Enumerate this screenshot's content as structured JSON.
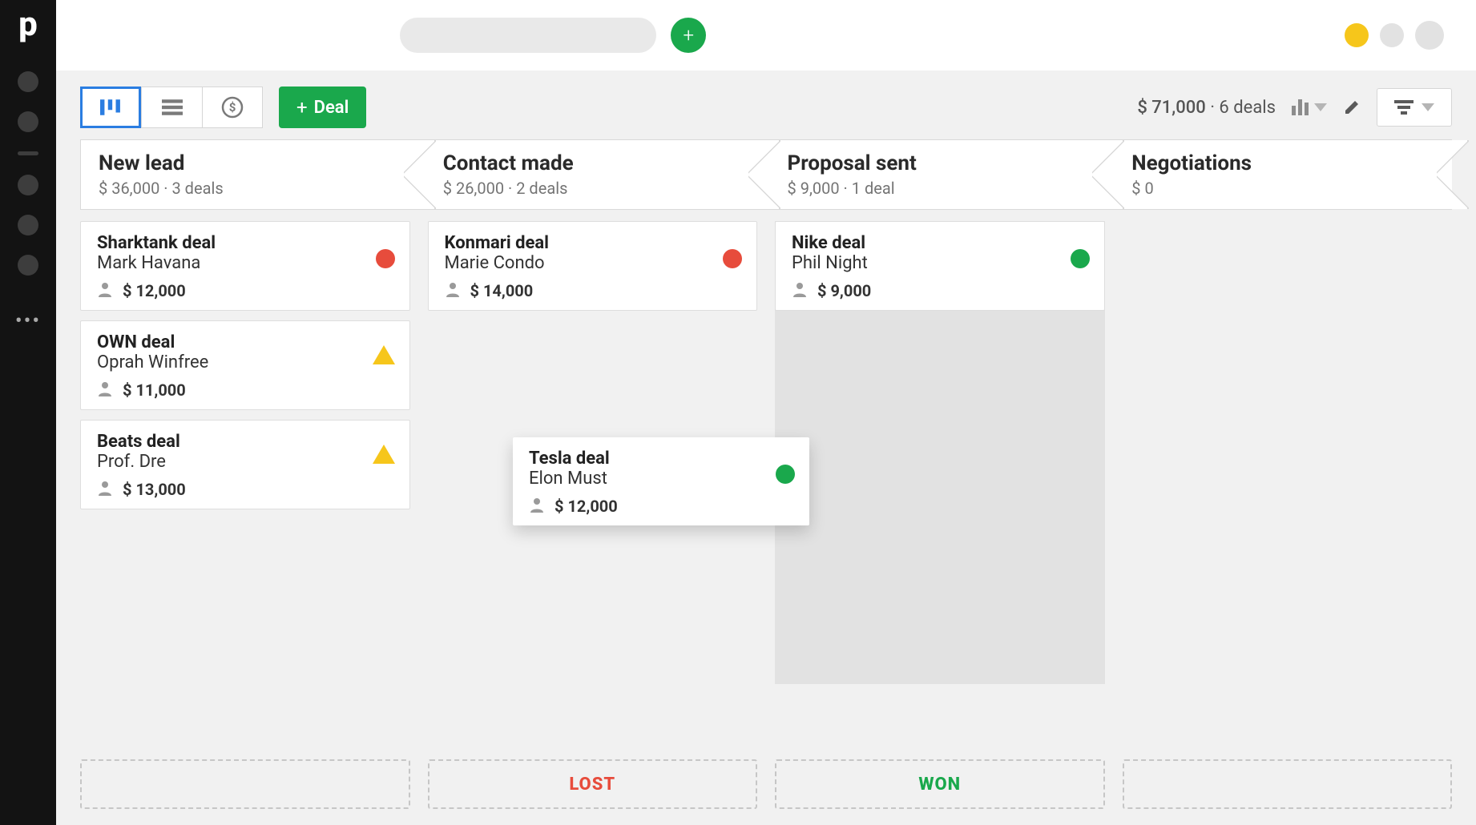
{
  "logo": "p",
  "toolbar": {
    "add_deal_label": "Deal",
    "total_amount": "$ 71,000",
    "total_deals": "6 deals"
  },
  "stages": [
    {
      "title": "New lead",
      "subtitle": "$ 36,000 · 3 deals"
    },
    {
      "title": "Contact made",
      "subtitle": "$ 26,000 · 2 deals"
    },
    {
      "title": "Proposal sent",
      "subtitle": "$ 9,000 · 1 deal"
    },
    {
      "title": "Negotiations",
      "subtitle": "$ 0"
    }
  ],
  "columns": {
    "new_lead": [
      {
        "title": "Sharktank deal",
        "contact": "Mark Havana",
        "amount": "$ 12,000",
        "status": "red"
      },
      {
        "title": "OWN deal",
        "contact": "Oprah Winfree",
        "amount": "$ 11,000",
        "status": "yellow"
      },
      {
        "title": "Beats deal",
        "contact": "Prof. Dre",
        "amount": "$ 13,000",
        "status": "yellow"
      }
    ],
    "contact_made": [
      {
        "title": "Konmari deal",
        "contact": "Marie Condo",
        "amount": "$ 14,000",
        "status": "red"
      }
    ],
    "proposal_sent": [
      {
        "title": "Nike deal",
        "contact": "Phil Night",
        "amount": "$ 9,000",
        "status": "green"
      }
    ],
    "negotiations": []
  },
  "dragging_card": {
    "title": "Tesla deal",
    "contact": "Elon Must",
    "amount": "$ 12,000",
    "status": "green"
  },
  "dropzones": {
    "lost": "LOST",
    "won": "WON"
  }
}
